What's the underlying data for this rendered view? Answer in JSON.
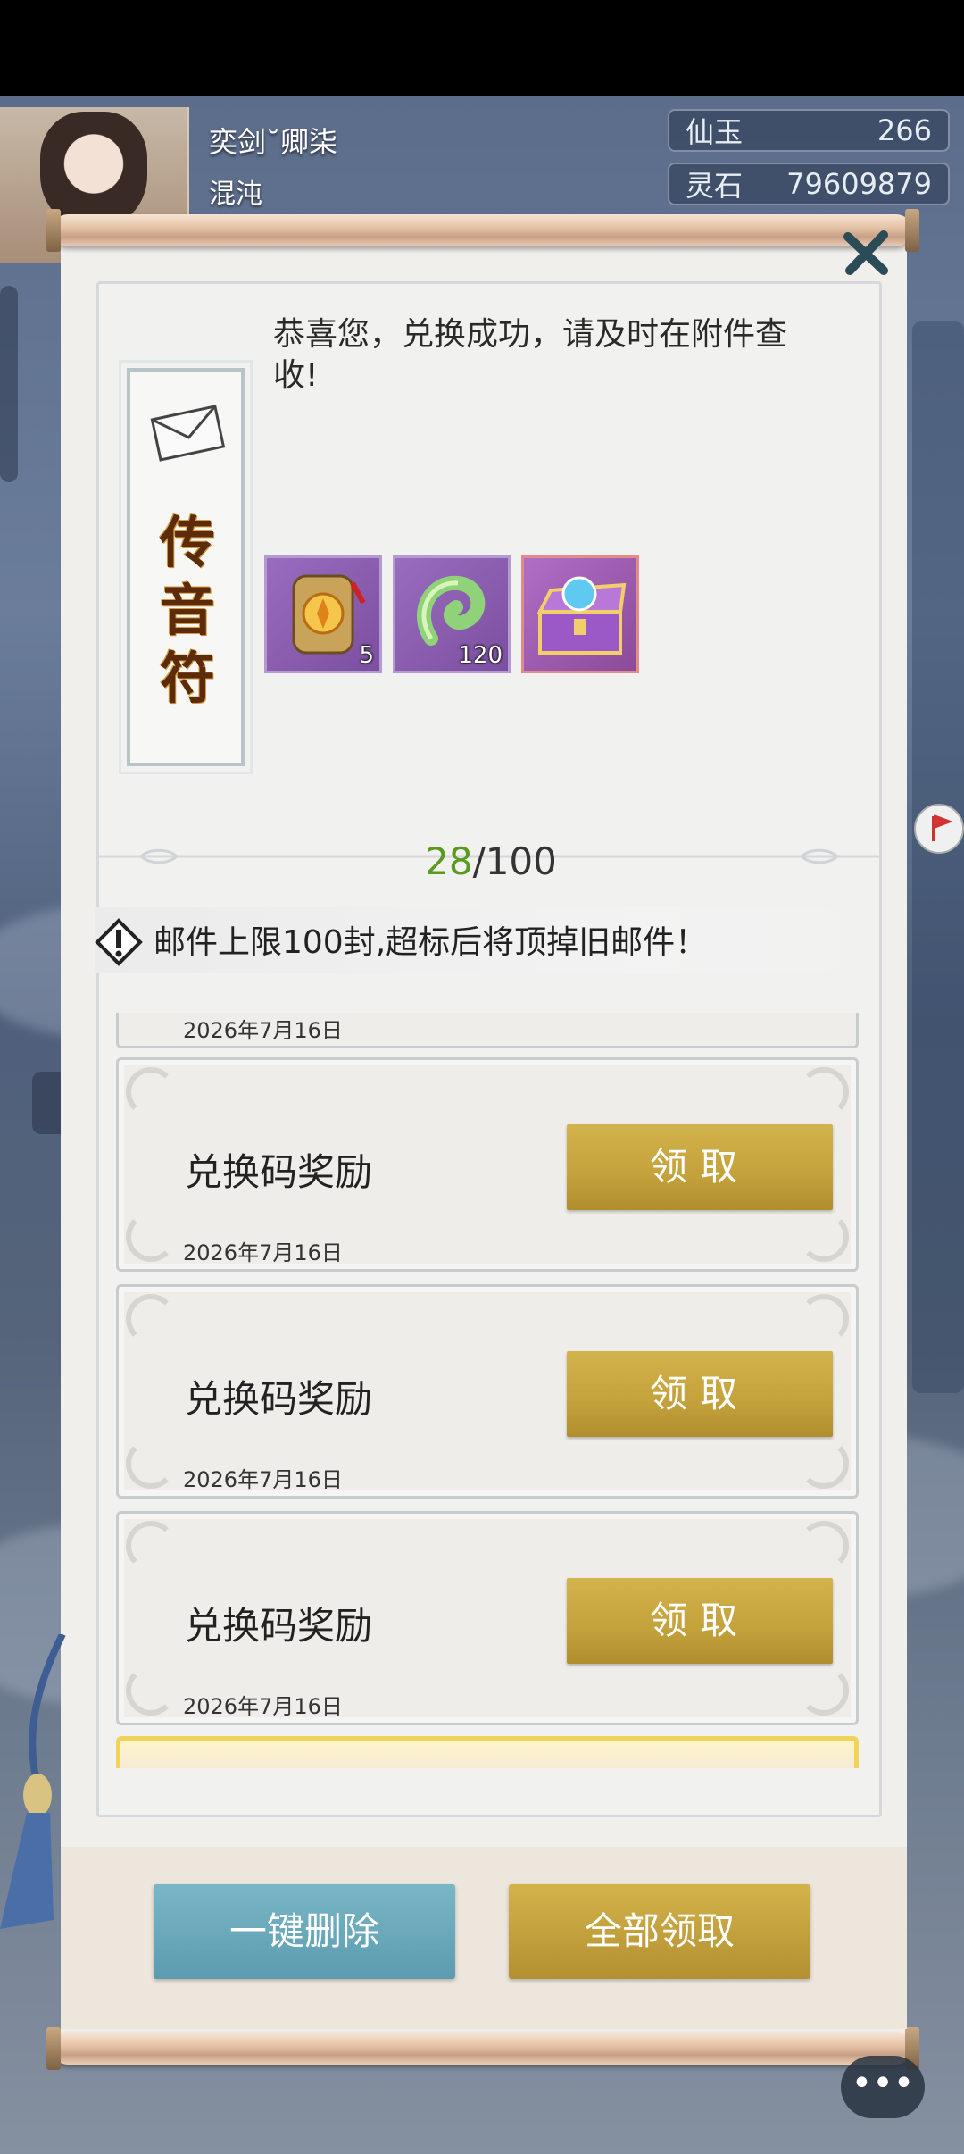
{
  "player": {
    "name": "奕剑˘卿柒",
    "realm": "混沌"
  },
  "resources": [
    {
      "label": "仙玉",
      "value": "266"
    },
    {
      "label": "灵石",
      "value": "79609879"
    }
  ],
  "mail_detail": {
    "talisman_chars": [
      "传",
      "音",
      "符"
    ],
    "message": "恭喜您，兑换成功，请及时在附件查收!",
    "rewards": [
      {
        "icon": "token-icon",
        "count": "5"
      },
      {
        "icon": "jade-icon",
        "count": "120"
      },
      {
        "icon": "treasure-chest-icon",
        "count": ""
      }
    ]
  },
  "mail_count": {
    "current": "28",
    "max": "/100"
  },
  "notice": "邮件上限100封,超标后将顶掉旧邮件！",
  "mail_list": {
    "partial_date": "2026年7月16日",
    "items": [
      {
        "title": "兑换码奖励",
        "date": "2026年7月16日",
        "button": "领取"
      },
      {
        "title": "兑换码奖励",
        "date": "2026年7月16日",
        "button": "领取"
      },
      {
        "title": "兑换码奖励",
        "date": "2026年7月16日",
        "button": "领取"
      }
    ]
  },
  "actions": {
    "delete_all": "一键删除",
    "claim_all": "全部领取"
  },
  "colors": {
    "gold_button": "#c3a13b",
    "blue_button": "#6aa8bb",
    "count_green": "#5a9a1e"
  }
}
